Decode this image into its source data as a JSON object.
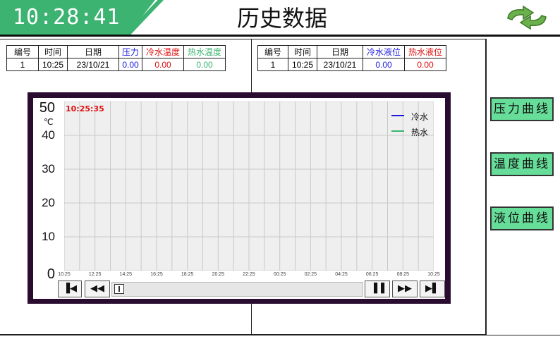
{
  "header": {
    "clock": "10:28:41",
    "title": "历史数据",
    "back_icon": "refresh-arrows-icon"
  },
  "left_table": {
    "headers": [
      "编号",
      "时间",
      "日期",
      "压力",
      "冷水温度",
      "热水温度"
    ],
    "header_colors": [
      "#111111",
      "#111111",
      "#111111",
      "#1a1adf",
      "#e01010",
      "#3cb371"
    ],
    "row": [
      "1",
      "10:25",
      "23/10/21",
      "0.00",
      "0.00",
      "0.00"
    ]
  },
  "right_table": {
    "headers": [
      "编号",
      "时间",
      "日期",
      "冷水液位",
      "热水液位"
    ],
    "header_colors": [
      "#111111",
      "#111111",
      "#111111",
      "#1a1adf",
      "#e01010"
    ],
    "row": [
      "1",
      "10:25",
      "23/10/21",
      "0.00",
      "0.00"
    ]
  },
  "chart_data": {
    "type": "line",
    "cursor_time": "10:25:35",
    "yunit": "℃",
    "ylim": [
      0,
      50
    ],
    "yticks": [
      "50",
      "40",
      "30",
      "20",
      "10",
      "0"
    ],
    "x": [
      "10:25",
      "12:25",
      "14:25",
      "16:25",
      "18:25",
      "20:25",
      "22:25",
      "00:25",
      "02:25",
      "04:25",
      "06:25",
      "08:25",
      "10:25"
    ],
    "series": [
      {
        "name": "冷水",
        "color": "#1a1adf",
        "values": []
      },
      {
        "name": "热水",
        "color": "#3cb371",
        "values": []
      }
    ],
    "grid": true,
    "legend": "top-right"
  },
  "nav": {
    "first": "▐◀",
    "rewind": "◀◀",
    "pause": "▐▐",
    "forward": "▶▶",
    "last": "▶▌"
  },
  "side_buttons": {
    "pressure": "压力曲线",
    "temperature": "温度曲线",
    "level": "液位曲线"
  }
}
